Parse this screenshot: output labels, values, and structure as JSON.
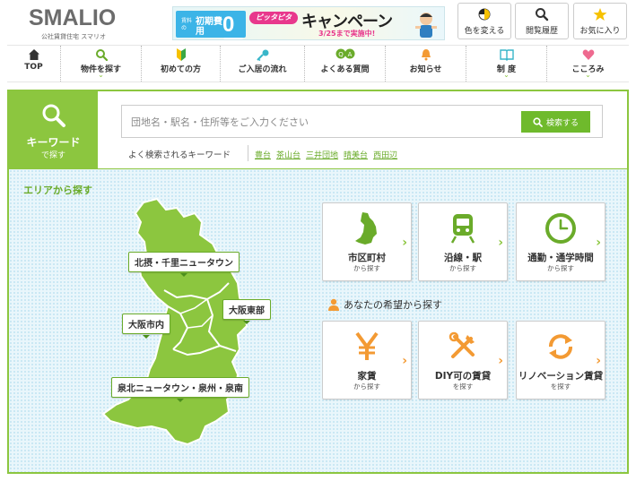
{
  "header": {
    "logo_text": "SMALIO",
    "logo_sub": "公社賃貸住宅 スマリオ",
    "banner": {
      "line1": "賃料の",
      "line2": "初期費用",
      "zero": "0円",
      "pink": "ピッタピタ",
      "campaign": "キャンペーン",
      "date": "3/25まで実施中!"
    },
    "buttons": [
      {
        "label": "色を変える",
        "icon": "color-circle-icon"
      },
      {
        "label": "閲覧履歴",
        "icon": "search-icon"
      },
      {
        "label": "お気に入り",
        "icon": "star-icon"
      }
    ]
  },
  "nav": [
    {
      "label": "TOP",
      "icon": "home-icon",
      "has_dropdown": false
    },
    {
      "label": "物件を探す",
      "icon": "search-icon",
      "has_dropdown": true
    },
    {
      "label": "初めての方",
      "icon": "beginner-mark-icon",
      "has_dropdown": false
    },
    {
      "label": "ご入居の流れ",
      "icon": "key-icon",
      "has_dropdown": false
    },
    {
      "label": "よくある質問",
      "icon": "qa-icon",
      "has_dropdown": false
    },
    {
      "label": "お知らせ",
      "icon": "bell-icon",
      "has_dropdown": false
    },
    {
      "label": "制 度",
      "icon": "book-icon",
      "has_dropdown": true
    },
    {
      "label": "こころみ",
      "icon": "heart-icon",
      "has_dropdown": true
    }
  ],
  "keyword": {
    "side_title": "キーワード",
    "side_sub": "で探す",
    "placeholder": "団地名・駅名・住所等をご入力ください",
    "value": "",
    "search_button": "検索する",
    "popular_label": "よく検索されるキーワード",
    "links": [
      "豊台",
      "茶山台",
      "三井団地",
      "晴美台",
      "西田辺"
    ]
  },
  "area": {
    "title": "エリアから探す",
    "regions": [
      "北摂・千里ニュータウン",
      "大阪東部",
      "大阪市内",
      "泉北ニュータウン・泉州・泉南"
    ]
  },
  "cards_area": [
    {
      "title": "市区町村",
      "sub": "から探す",
      "icon": "osaka-map-icon"
    },
    {
      "title": "沿線・駅",
      "sub": "から探す",
      "icon": "train-icon"
    },
    {
      "title": "通勤・通学時間",
      "sub": "から探す",
      "icon": "clock-icon"
    }
  ],
  "wish": {
    "heading": "あなたの希望から探す",
    "cards": [
      {
        "title": "家賃",
        "sub": "から探す",
        "icon": "yen-icon"
      },
      {
        "title": "DIY可の賃貸",
        "sub": "を探す",
        "icon": "tools-icon"
      },
      {
        "title": "リノベーション賃貸",
        "sub": "を探す",
        "icon": "renovation-icon"
      }
    ]
  },
  "colors": {
    "accent_green": "#8cc63f",
    "dark_green": "#6aab2a",
    "orange": "#f39a33",
    "map_bg": "#e9f6fb"
  }
}
